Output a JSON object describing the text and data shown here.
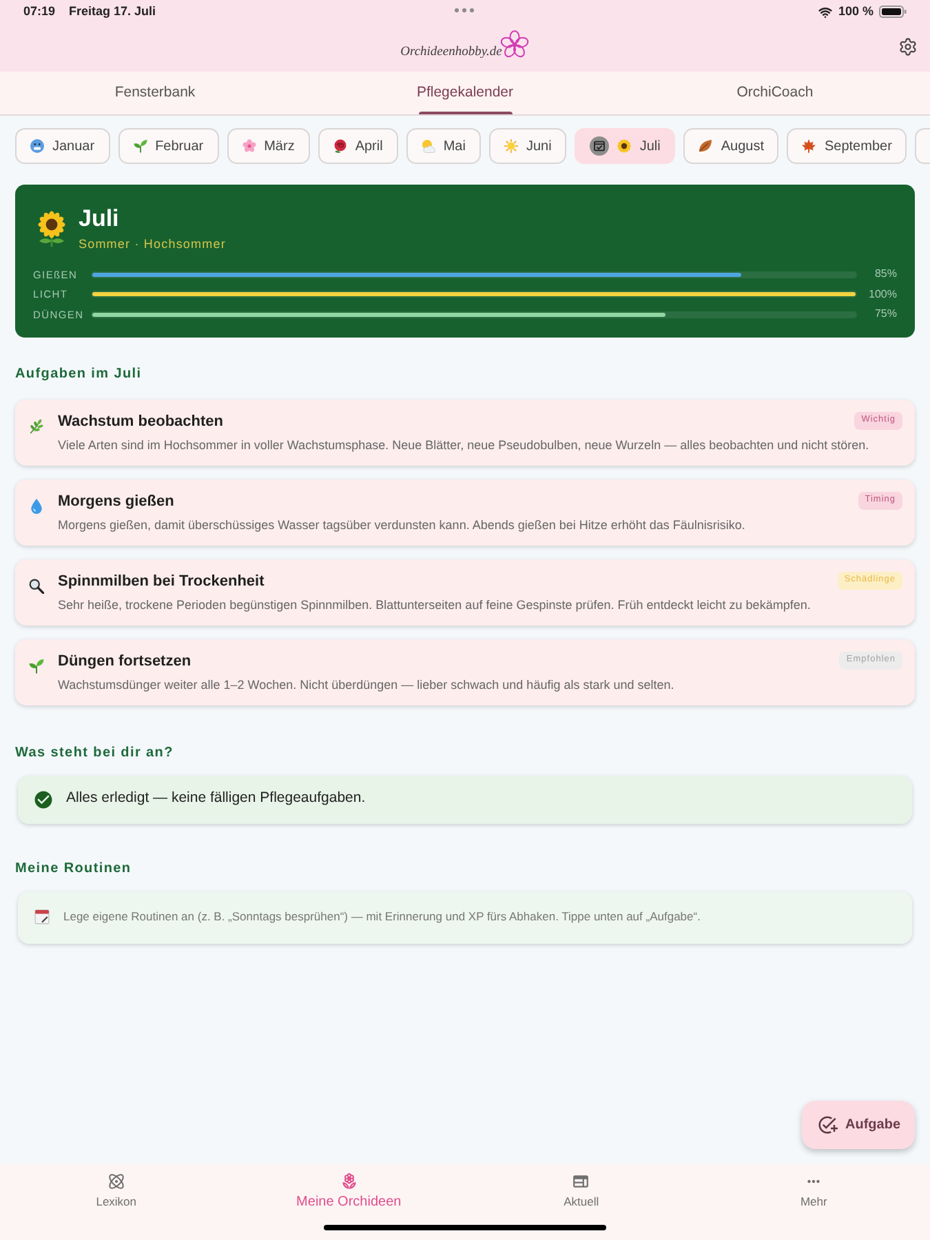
{
  "status_bar": {
    "time": "07:19",
    "date": "Freitag 17. Juli",
    "battery": "100 %"
  },
  "header": {
    "logo": "Orchideenhobby.de"
  },
  "tabs": [
    {
      "label": "Fensterbank",
      "selected": false
    },
    {
      "label": "Pflegekalender",
      "selected": true
    },
    {
      "label": "OrchiCoach",
      "selected": false
    }
  ],
  "months": [
    {
      "label": "Januar",
      "selected": false,
      "current": false
    },
    {
      "label": "Februar",
      "selected": false,
      "current": false
    },
    {
      "label": "März",
      "selected": false,
      "current": false
    },
    {
      "label": "April",
      "selected": false,
      "current": false
    },
    {
      "label": "Mai",
      "selected": false,
      "current": false
    },
    {
      "label": "Juni",
      "selected": false,
      "current": false
    },
    {
      "label": "Juli",
      "selected": true,
      "current": true
    },
    {
      "label": "August",
      "selected": false,
      "current": false
    },
    {
      "label": "September",
      "selected": false,
      "current": false
    }
  ],
  "month_card": {
    "title": "Juli",
    "subtitle": "Sommer · Hochsommer",
    "meters": [
      {
        "label": "GIEßEN",
        "level": 0.85,
        "reading": "85%",
        "color": "#4ea6e3"
      },
      {
        "label": "LICHT",
        "level": 1,
        "reading": "100%",
        "color": "#f2d33f"
      },
      {
        "label": "DÜNGEN",
        "level": 0.75,
        "reading": "75%",
        "color": "#8fd6a0"
      }
    ]
  },
  "tasks_section": {
    "heading": "Aufgaben im Juli",
    "tasks": [
      {
        "title": "Wachstum beobachten",
        "text": "Viele Arten sind im Hochsommer in voller Wachstumsphase. Neue Blätter, neue Pseudobulben, neue Wurzeln — alles beobachten und nicht stören.",
        "tag": {
          "label": "Wichtig",
          "color": "#f8d5df"
        }
      },
      {
        "title": "Morgens gießen",
        "text": "Morgens gießen, damit überschüssiges Wasser tagsüber verdunsten kann. Abends gießen bei Hitze erhöht das Fäulnisrisiko.",
        "tag": {
          "label": "Timing",
          "color": "#f8d5df"
        }
      },
      {
        "title": "Spinnmilben bei Trockenheit",
        "text": "Sehr heiße, trockene Perioden begünstigen Spinnmilben. Blattunterseiten auf feine Gespinste prüfen. Früh entdeckt leicht zu bekämpfen.",
        "tag": {
          "label": "Schädlinge",
          "color": "#fdefc5"
        }
      },
      {
        "title": "Düngen fortsetzen",
        "text": "Wachstumsdünger weiter alle 1–2 Wochen. Nicht überdüngen — lieber schwach und häufig als stark und selten.",
        "tag": {
          "label": "Empfohlen",
          "color": "#ececec"
        }
      }
    ]
  },
  "status_section": {
    "heading": "Was steht bei dir an?",
    "message": "Alles erledigt — keine fälligen Pflegeaufgaben."
  },
  "routines_section": {
    "heading": "Meine Routinen",
    "hint": "Lege eigene Routinen an (z. B. „Sonntags besprühen“) — mit Erinnerung und XP fürs Abhaken. Tippe unten auf „Aufgabe“."
  },
  "fab": {
    "label": "Aufgabe"
  },
  "bottom_nav": [
    {
      "label": "Lexikon",
      "selected": false
    },
    {
      "label": "Meine Orchideen",
      "selected": true
    },
    {
      "label": "Aktuell",
      "selected": false
    },
    {
      "label": "Mehr",
      "selected": false
    }
  ]
}
